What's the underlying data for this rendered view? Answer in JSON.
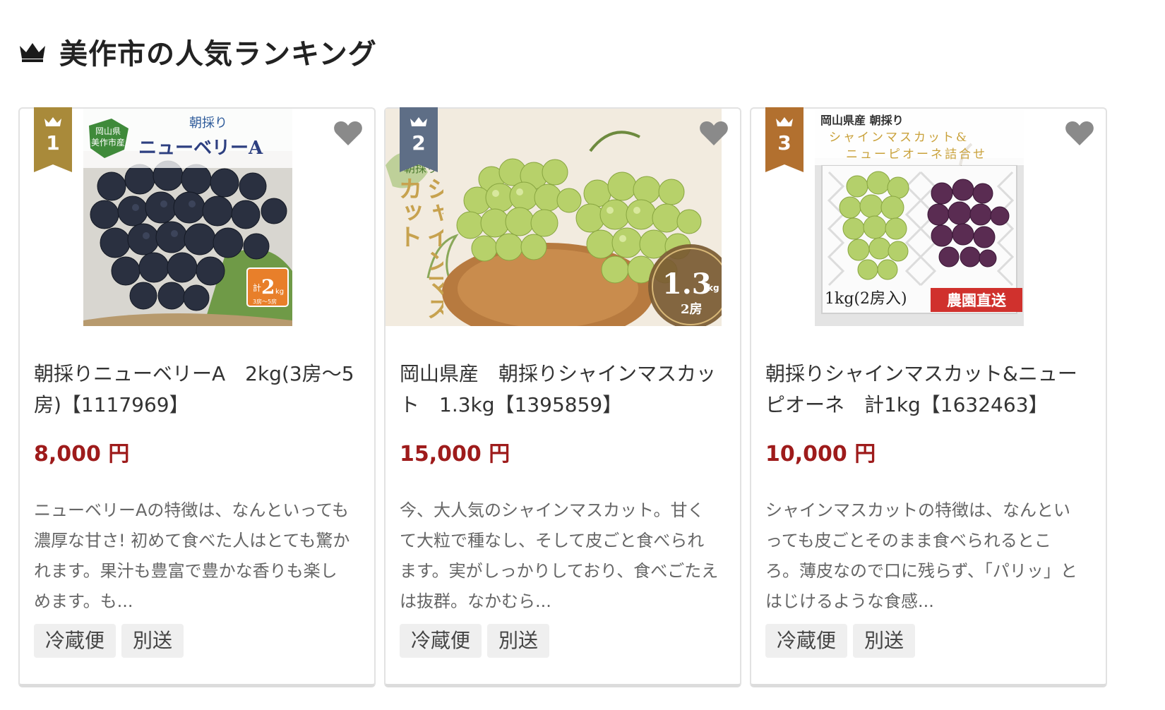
{
  "section": {
    "title": "美作市の人気ランキング",
    "icon": "crown-icon"
  },
  "colors": {
    "rank_1": "#a98a3a",
    "rank_2": "#5e6e86",
    "rank_3": "#b2702f",
    "price": "#9e1b1b"
  },
  "products": [
    {
      "rank": "1",
      "name": "朝採りニューベリーA　2kg(3房〜5房)【1117969】",
      "price": "8,000 円",
      "description": "ニューベリーAの特徴は、なんといっても濃厚な甘さ! 初めて食べた人はとても驚かれます。果汁も豊富で豊かな香りも楽しめます。も...",
      "tags": [
        "冷蔵便",
        "別送"
      ],
      "image_text": {
        "origin": "岡山県美作市産",
        "badge": "朝採り",
        "title": "ニューベリーA",
        "weight": "2",
        "weight_prefix": "計",
        "weight_unit": "kg",
        "weight_note": "3房〜5房"
      }
    },
    {
      "rank": "2",
      "name": "岡山県産　朝採りシャインマスカット　1.3kg【1395859】",
      "price": "15,000 円",
      "description": "今、大人気のシャインマスカット。甘くて大粒で種なし、そして皮ごと食べられます。実がしっかりしており、食べごたえは抜群。なかむら...",
      "tags": [
        "冷蔵便",
        "別送"
      ],
      "image_text": {
        "badge": "朝採り",
        "title": "シャインマスカット",
        "weight": "1.3",
        "weight_unit": "kg",
        "bunches": "2房"
      }
    },
    {
      "rank": "3",
      "name": "朝採りシャインマスカット&ニューピオーネ　計1kg【1632463】",
      "price": "10,000 円",
      "description": "シャインマスカットの特徴は、なんといっても皮ごとそのまま食べられるところ。薄皮なので口に残らず、「パリッ」とはじけるような食感...",
      "tags": [
        "冷蔵便",
        "別送"
      ],
      "image_text": {
        "line1": "岡山県産 朝採り",
        "line2": "シャインマスカット&",
        "line3": "ニューピオーネ詰合せ",
        "weight": "1kg(2房入)",
        "badge": "農園直送"
      }
    }
  ]
}
